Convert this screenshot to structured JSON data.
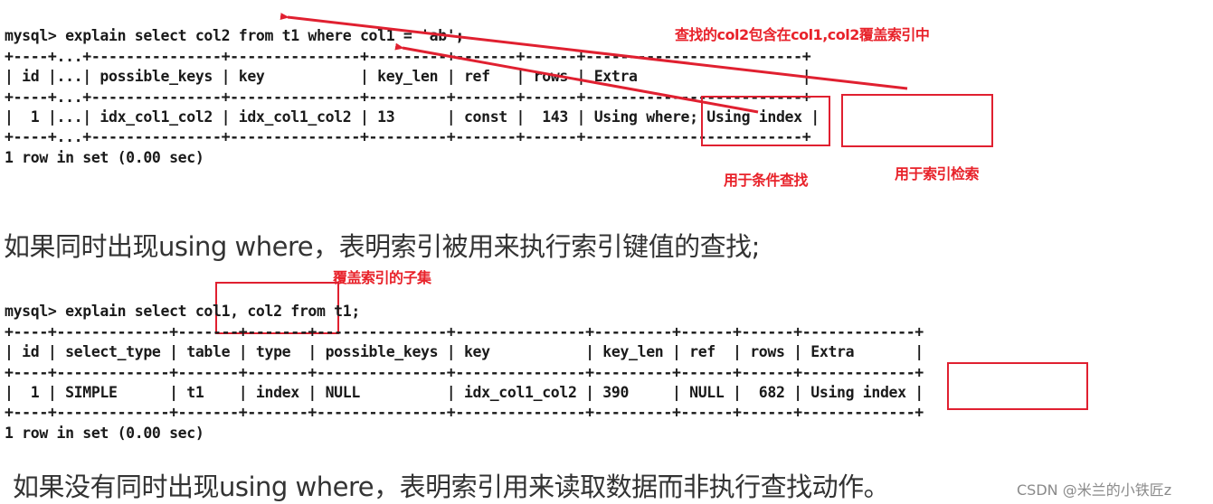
{
  "query1": {
    "prompt": "mysql> explain select col2 from t1 where col1 = 'ab';",
    "border": "+----+...+---------------+---------------+---------+-------+------+-------------------------+",
    "header": "| id |...| possible_keys | key           | key_len | ref   | rows | Extra                   |",
    "row": "|  1 |...| idx_col1_col2 | idx_col1_col2 | 13      | const |  143 | Using where; Using index |",
    "columns": [
      "id",
      "...",
      "possible_keys",
      "key",
      "key_len",
      "ref",
      "rows",
      "Extra"
    ],
    "values": [
      "1",
      "...",
      "idx_col1_col2",
      "idx_col1_col2",
      "13",
      "const",
      "143",
      "Using where; Using index"
    ],
    "footer": "1 row in set (0.00 sec)"
  },
  "annotations1": {
    "top_note": "查找的col2包含在col1,col2覆盖索引中",
    "where_note": "用于条件查找",
    "index_note": "用于索引检索"
  },
  "paragraph1": "如果同时出现using where，表明索引被用来执行索引键值的查找;",
  "annotations2": {
    "subset_note": "覆盖索引的子集"
  },
  "query2": {
    "prompt": "mysql> explain select col1, col2 from t1;",
    "border": "+----+-------------+-------+-------+---------------+---------------+---------+------+------+-------------+",
    "header": "| id | select_type | table | type  | possible_keys | key           | key_len | ref  | rows | Extra       |",
    "row": "|  1 | SIMPLE      | t1    | index | NULL          | idx_col1_col2 | 390     | NULL |  682 | Using index |",
    "columns": [
      "id",
      "select_type",
      "table",
      "type",
      "possible_keys",
      "key",
      "key_len",
      "ref",
      "rows",
      "Extra"
    ],
    "values": [
      "1",
      "SIMPLE",
      "t1",
      "index",
      "NULL",
      "idx_col1_col2",
      "390",
      "NULL",
      "682",
      "Using index"
    ],
    "footer": "1 row in set (0.00 sec)"
  },
  "paragraph2": "如果没有同时出现using where，表明索引用来读取数据而非执行查找动作。",
  "watermark": "CSDN @米兰的小铁匠z",
  "colors": {
    "annotation_red": "#e8222a",
    "terminal_text": "#1a1a1a",
    "prose_text": "#333333"
  }
}
